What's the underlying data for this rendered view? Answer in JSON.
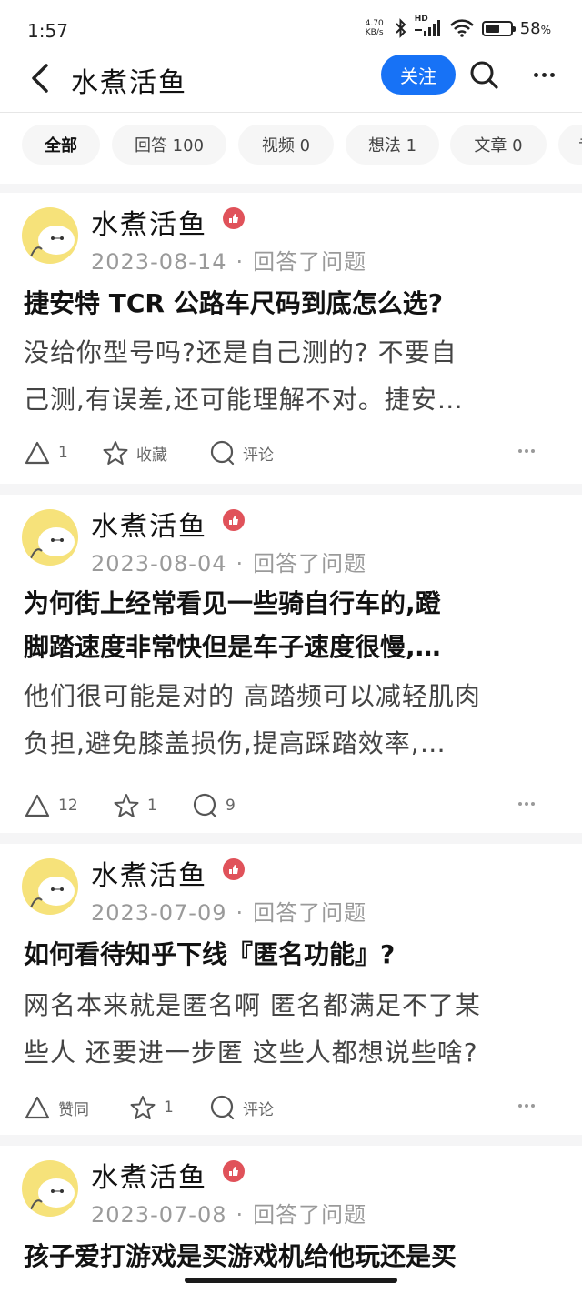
{
  "status_bar": {
    "time": "1:57",
    "net_speed_value": "4.70",
    "net_speed_unit": "KB/s",
    "hd_label": "HD",
    "battery_percent": "58",
    "battery_unit": "%",
    "battery_level": 0.58
  },
  "header": {
    "title": "水煮活鱼",
    "follow_label": "关注"
  },
  "tabs": [
    {
      "label": "全部"
    },
    {
      "label": "回答 100"
    },
    {
      "label": "视频 0"
    },
    {
      "label": "想法 1"
    },
    {
      "label": "文章 0"
    },
    {
      "label": "专"
    }
  ],
  "feed": [
    {
      "author": "水煮活鱼",
      "date": "2023-08-14",
      "sep": "·",
      "action_text": "回答了问题",
      "title": "捷安特 TCR 公路车尺码到底怎么选?",
      "excerpt_line1": "没给你型号吗?还是自己测的? 不要自",
      "excerpt_line2": "己测,有误差,还可能理解不对。捷安…",
      "vote": "1",
      "favorite": "收藏",
      "comment": "评论"
    },
    {
      "author": "水煮活鱼",
      "date": "2023-08-04",
      "sep": "·",
      "action_text": "回答了问题",
      "title_line1": "为何街上经常看见一些骑自行车的,蹬",
      "title_line2": "脚踏速度非常快但是车子速度很慢,…",
      "excerpt_line1": "他们很可能是对的 高踏频可以减轻肌肉",
      "excerpt_line2": "负担,避免膝盖损伤,提高踩踏效率,…",
      "vote": "12",
      "favorite": "1",
      "comment": "9"
    },
    {
      "author": "水煮活鱼",
      "date": "2023-07-09",
      "sep": "·",
      "action_text": "回答了问题",
      "title": "如何看待知乎下线『匿名功能』?",
      "excerpt_line1": "网名本来就是匿名啊 匿名都满足不了某",
      "excerpt_line2": "些人 还要进一步匿 这些人都想说些啥?",
      "vote": "赞同",
      "favorite": "1",
      "comment": "评论"
    },
    {
      "author": "水煮活鱼",
      "date": "2023-07-08",
      "sep": "·",
      "action_text": "回答了问题",
      "title": "孩子爱打游戏是买游戏机给他玩还是买"
    }
  ],
  "colors": {
    "accent": "#1772f6",
    "badge": "#e0525a",
    "avatar_bg": "#f6e27a"
  }
}
